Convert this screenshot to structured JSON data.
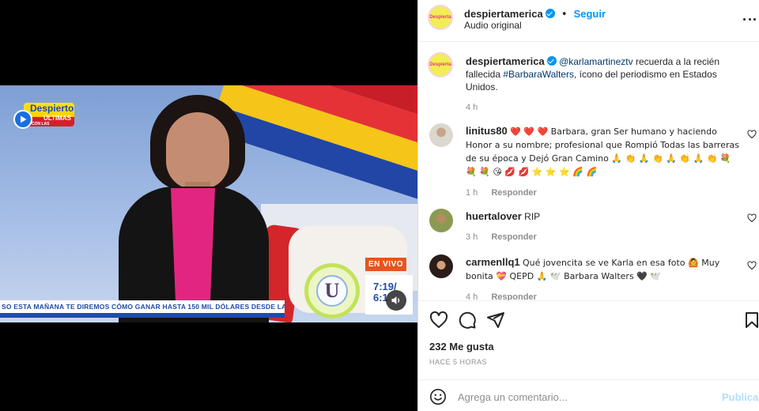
{
  "colors": {
    "accent": "#0095f6",
    "heart": "#ed4956",
    "muted": "#8e8e8e",
    "live_badge": "#e8541f",
    "ticker_blue": "#1f4ca8"
  },
  "video": {
    "show_logo_line1": "Despierto",
    "show_logo_line2": "ÚLTIMAS",
    "show_logo_line3": "CON LAS",
    "live_badge": "EN VIVO",
    "network_logo": "U",
    "clock_time": "7:19/",
    "clock_temp": "6:1",
    "ticker_text": "SO ESTA MAÑANA TE DIREMOS CÓMO GANAR HASTA 150 MIL DÓLARES DESDE LA SA",
    "play_icon": "play-icon",
    "mute_icon": "speaker-icon"
  },
  "header": {
    "username": "despiertamerica",
    "follow_label": "Seguir",
    "audio_label": "Audio original",
    "avatar_text": "Despierta"
  },
  "caption": {
    "username": "despiertamerica",
    "mention": "@karlamartineztv",
    "text_after_mention": " recuerda a la recién fallecida ",
    "hashtag": "#BarbaraWalters",
    "text_end": ", ícono del periodismo en Estados Unidos.",
    "time": "4 h"
  },
  "comments": [
    {
      "username": "linitus80",
      "text": "❤️ ❤️ ❤️  Barbara, gran Ser humano y haciendo Honor a su nombre; profesional que Rompió Todas las barreras de su época y Dejó Gran Camino 🙏 👏 🙏 👏 🙏 👏 🙏 👏 💐 💐 💐 😘 💋 💋 ⭐ ⭐ ⭐ 🌈 🌈",
      "time": "1 h",
      "reply_label": "Responder"
    },
    {
      "username": "huertalover",
      "text": "RIP",
      "time": "3 h",
      "reply_label": "Responder"
    },
    {
      "username": "carmenllq1",
      "text": "Qué jovencita se ve Karla en esa foto 🙆 Muy bonita 💝 QEPD 🙏 🕊️ Barbara Walters 🖤 🕊️",
      "time": "4 h",
      "reply_label": "Responder"
    }
  ],
  "actions": {
    "likes": "232 Me gusta",
    "timestamp": "HACE 5 HORAS"
  },
  "composer": {
    "placeholder": "Agrega un comentario...",
    "publish_label": "Publicar"
  }
}
